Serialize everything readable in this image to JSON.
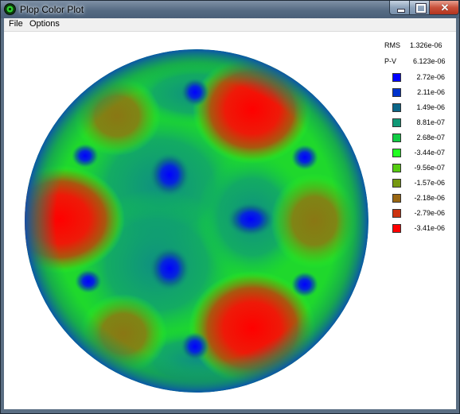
{
  "window": {
    "title": "Plop Color Plot"
  },
  "menu": {
    "items": [
      "File",
      "Options"
    ]
  },
  "stats": {
    "rms_label": "RMS",
    "rms_value": "1.326e-06",
    "pv_label": "P-V",
    "pv_value": "6.123e-06"
  },
  "legend": {
    "entries": [
      {
        "label": "2.72e-06",
        "color": "#0000ff"
      },
      {
        "label": "2.11e-06",
        "color": "#0033cc"
      },
      {
        "label": "1.49e-06",
        "color": "#0b6688"
      },
      {
        "label": "8.81e-07",
        "color": "#109977"
      },
      {
        "label": "2.68e-07",
        "color": "#11cc44"
      },
      {
        "label": "-3.44e-07",
        "color": "#22ff22"
      },
      {
        "label": "-9.56e-07",
        "color": "#55cc11"
      },
      {
        "label": "-1.57e-06",
        "color": "#779911"
      },
      {
        "label": "-2.18e-06",
        "color": "#996611"
      },
      {
        "label": "-2.79e-06",
        "color": "#cc3311"
      },
      {
        "label": "-3.41e-06",
        "color": "#ff0000"
      }
    ]
  },
  "icons": {
    "app": "plop-app-icon",
    "minimize": "minimize-icon",
    "maximize": "maximize-icon",
    "close": "close-icon"
  }
}
